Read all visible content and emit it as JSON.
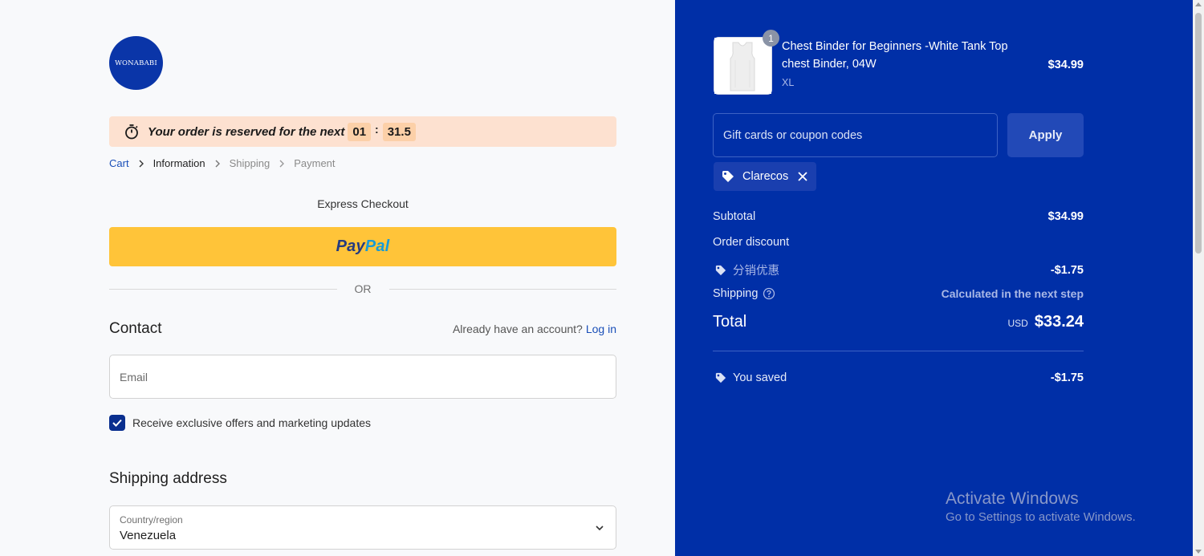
{
  "brand": {
    "logo_text": "WONABABI"
  },
  "reservation": {
    "message": "Your order is reserved for the next",
    "minutes": "01",
    "separator": ":",
    "seconds": "31.5"
  },
  "breadcrumb": {
    "cart": "Cart",
    "information": "Information",
    "shipping": "Shipping",
    "payment": "Payment"
  },
  "express": {
    "heading": "Express Checkout",
    "paypal_part1": "Pay",
    "paypal_part2": "Pal",
    "or_label": "OR"
  },
  "contact": {
    "heading": "Contact",
    "account_prompt": "Already have an account?",
    "login_label": "Log in",
    "email_placeholder": "Email",
    "offers_label": "Receive exclusive offers and marketing updates",
    "offers_checked": true
  },
  "shipping_address": {
    "heading": "Shipping address",
    "country_label": "Country/region",
    "country_value": "Venezuela"
  },
  "summary": {
    "product": {
      "title": "Chest Binder for Beginners -White Tank Top chest Binder, 04W",
      "variant": "XL",
      "price": "$34.99",
      "quantity": "1"
    },
    "coupon_placeholder": "Gift cards or coupon codes",
    "apply_label": "Apply",
    "applied_code": "Clarecos",
    "subtotal_label": "Subtotal",
    "subtotal_value": "$34.99",
    "order_discount_label": "Order discount",
    "discount_name": "分销优惠",
    "discount_value": "-$1.75",
    "shipping_label": "Shipping",
    "shipping_value": "Calculated in the next step",
    "total_label": "Total",
    "total_currency": "USD",
    "total_value": "$33.24",
    "saved_label": "You saved",
    "saved_value": "-$1.75"
  },
  "os_watermark": {
    "line1": "Activate Windows",
    "line2": "Go to Settings to activate Windows."
  },
  "colors": {
    "summary_bg": "#002fa7",
    "paypal_yellow": "#ffc439",
    "timer_bg": "#fde1d0",
    "link_blue": "#1a4fb8"
  }
}
